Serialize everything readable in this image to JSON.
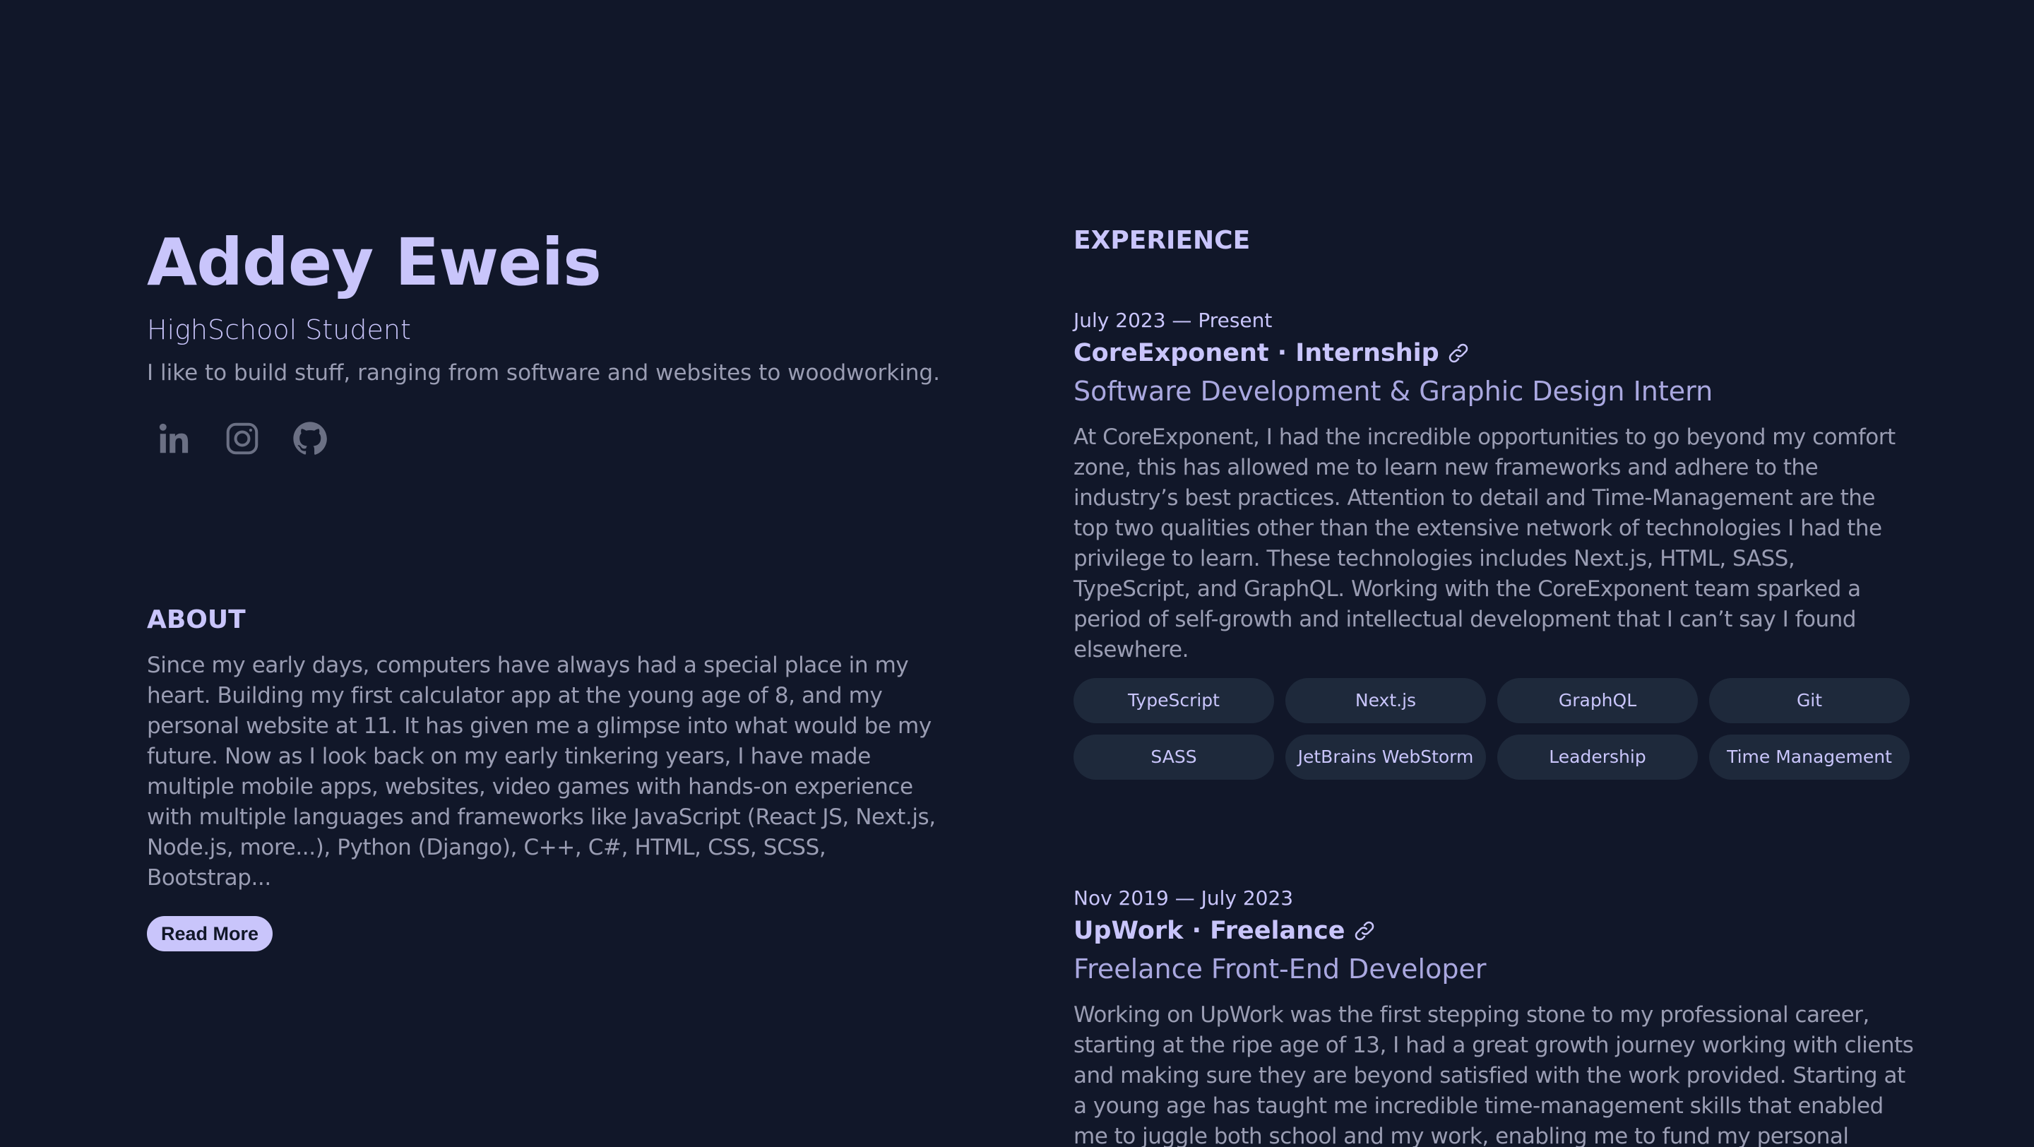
{
  "profile": {
    "name": "Addey Eweis",
    "role": "HighSchool Student",
    "tagline": "I like to build stuff, ranging from software and websites to woodworking.",
    "socials": [
      "linkedin-icon",
      "instagram-icon",
      "github-icon"
    ]
  },
  "about": {
    "title": "ABOUT",
    "text": "Since my early days, computers have always had a special place in my heart. Building my first calculator app at the young age of 8, and my personal website at 11. It has given me a glimpse into what would be my future. Now as I look back on my early tinkering years, I have made multiple mobile apps, websites, video games with hands-on experience with multiple languages and frameworks like JavaScript (React JS, Next.js, Node.js, more...), Python (Django), C++, C#, HTML, CSS, SCSS, Bootstrap...",
    "read_more": "Read More"
  },
  "experience": {
    "title": "EXPERIENCE",
    "jobs": [
      {
        "date": "July 2023 — Present",
        "company": "CoreExponent · Internship",
        "title": "Software Development & Graphic Design Intern",
        "description": "At CoreExponent, I had the incredible opportunities to go beyond my comfort zone, this has allowed me to learn new frameworks and adhere to the industry’s best practices. Attention to detail and Time-Management are the top two qualities other than the extensive network of technologies I had the privilege to learn. These technologies includes Next.js, HTML, SASS, TypeScript, and GraphQL. Working with the CoreExponent team sparked a period of self-growth and intellectual development that I can’t say I found elsewhere.",
        "tags": [
          "TypeScript",
          "Next.js",
          "GraphQL",
          "Git",
          "SASS",
          "JetBrains WebStorm",
          "Leadership",
          "Time Management"
        ]
      },
      {
        "date": "Nov 2019 — July 2023",
        "company": "UpWork · Freelance",
        "title": "Freelance Front-End Developer",
        "description": "Working on UpWork was the first stepping stone to my professional career, starting at the ripe age of 13, I had a great growth journey working with clients and making sure they are beyond satisfied with the work provided. Starting at a young age has taught me incredible time-management skills that enabled me to juggle both school and my work, enabling me to fund my personal programming"
      }
    ]
  },
  "colors": {
    "background": "#111729",
    "accent": "#c9c5fb",
    "muted_text": "#9a9db3",
    "tag_background": "#1e293b"
  }
}
